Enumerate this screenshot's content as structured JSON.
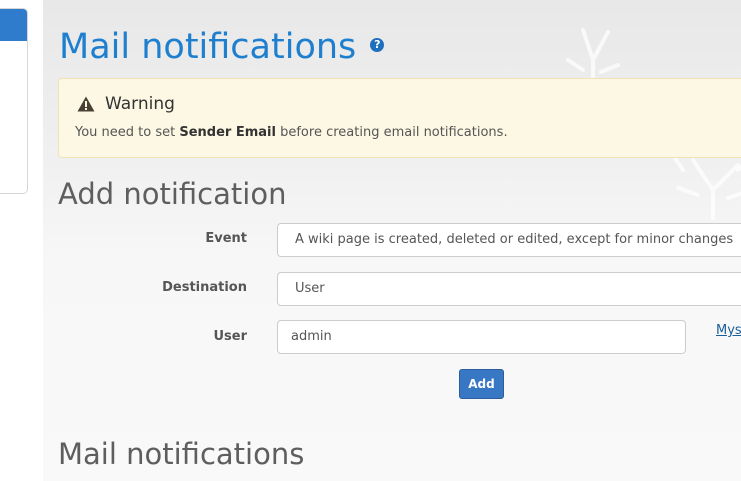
{
  "page": {
    "title": "Mail notifications",
    "help_icon": "?"
  },
  "warning": {
    "icon": "warning-triangle-icon",
    "title": "Warning",
    "msg_prefix": "You need to set",
    "msg_bold": "Sender Email",
    "msg_suffix": "before creating email notifications."
  },
  "add_section": {
    "heading": "Add notification",
    "event_label": "Event",
    "event_value": "A wiki page is created, deleted or edited, except for minor changes",
    "destination_label": "Destination",
    "destination_value": "User",
    "user_label": "User",
    "user_value": "admin",
    "myself_link": "Mys",
    "add_button": "Add"
  },
  "list_section": {
    "heading": "Mail notifications"
  },
  "colors": {
    "title": "#1f7fcf",
    "button": "#3777c4",
    "warning_bg": "#fcf8e3"
  }
}
